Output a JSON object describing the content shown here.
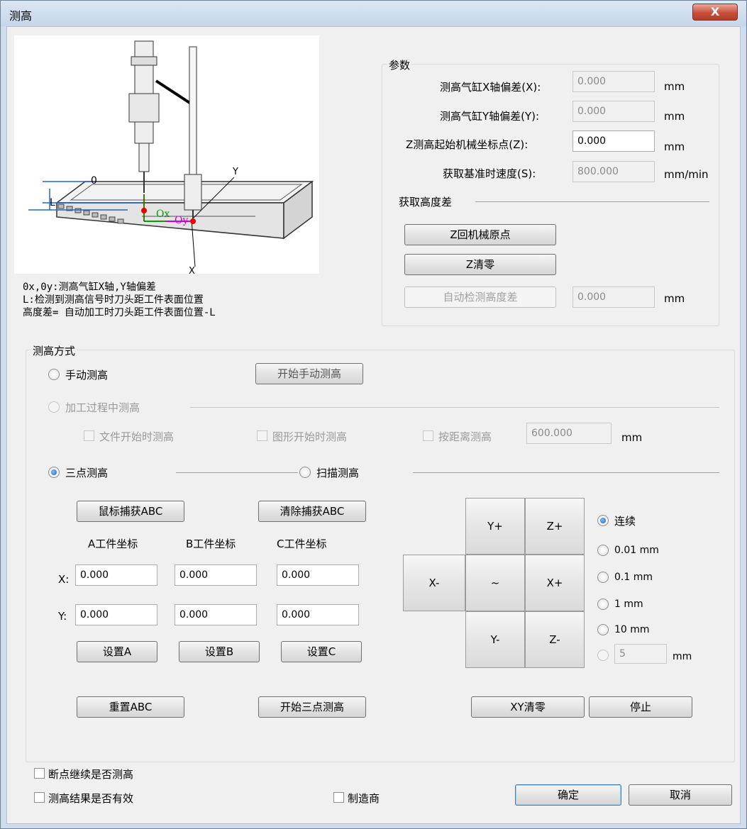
{
  "window": {
    "title": "测高",
    "close_label": "X"
  },
  "diagram": {
    "label_zero": "0",
    "label_l": "L",
    "label_x": "X",
    "label_y": "Y",
    "label_ox": "Ox",
    "label_oy": "Oy"
  },
  "description": [
    "0x,0y:测高气缸X轴,Y轴偏差",
    "L:检测到测高信号时刀头距工件表面位置",
    "高度差= 自动加工时刀头距工件表面位置-L"
  ],
  "params": {
    "group_title": "参数",
    "offset_x": {
      "label": "测高气缸X轴偏差(X):",
      "value": "0.000",
      "unit": "mm"
    },
    "offset_y": {
      "label": "测高气缸Y轴偏差(Y):",
      "value": "0.000",
      "unit": "mm"
    },
    "z_start": {
      "label": "Z测高起始机械坐标点(Z):",
      "value": "0.000",
      "unit": "mm"
    },
    "speed": {
      "label": "获取基准时速度(S):",
      "value": "800.000",
      "unit": "mm/min"
    },
    "height_diff_title": "获取高度差",
    "z_home_button": "Z回机械原点",
    "z_zero_button": "Z清零",
    "auto_detect_button": "自动检测高度差",
    "auto_detect_value": "0.000",
    "auto_detect_unit": "mm"
  },
  "method": {
    "group_title": "测高方式",
    "manual_label": "手动测高",
    "manual_start_button": "开始手动测高",
    "in_process_label": "加工过程中测高",
    "file_start_label": "文件开始时测高",
    "shape_start_label": "图形开始时测高",
    "by_distance_label": "按距离测高",
    "distance_value": "600.000",
    "distance_unit": "mm",
    "three_point_label": "三点测高",
    "scan_label": "扫描测高",
    "mouse_capture_button": "鼠标捕获ABC",
    "clear_capture_button": "清除捕获ABC",
    "col_a": "A工件坐标",
    "col_b": "B工件坐标",
    "col_c": "C工件坐标",
    "row_x": "X:",
    "row_y": "Y:",
    "ax": "0.000",
    "bx": "0.000",
    "cx": "0.000",
    "ay": "0.000",
    "by": "0.000",
    "cy": "0.000",
    "set_a": "设置A",
    "set_b": "设置B",
    "set_c": "设置C",
    "reset_abc": "重置ABC",
    "start_three_point": "开始三点测高"
  },
  "jog": {
    "y_plus": "Y+",
    "z_plus": "Z+",
    "x_minus": "X-",
    "center": "~",
    "x_plus": "X+",
    "y_minus": "Y-",
    "z_minus": "Z-",
    "step_continuous": "连续",
    "step_001": "0.01 mm",
    "step_01": "0.1 mm",
    "step_1": "1 mm",
    "step_10": "10 mm",
    "step_custom_value": "5",
    "step_custom_unit": "mm",
    "xy_zero_button": "XY清零",
    "stop_button": "停止"
  },
  "footer": {
    "resume_check": "断点继续是否测高",
    "result_valid_check": "测高结果是否有效",
    "manufacturer_check": "制造商",
    "ok_button": "确定",
    "cancel_button": "取消"
  }
}
